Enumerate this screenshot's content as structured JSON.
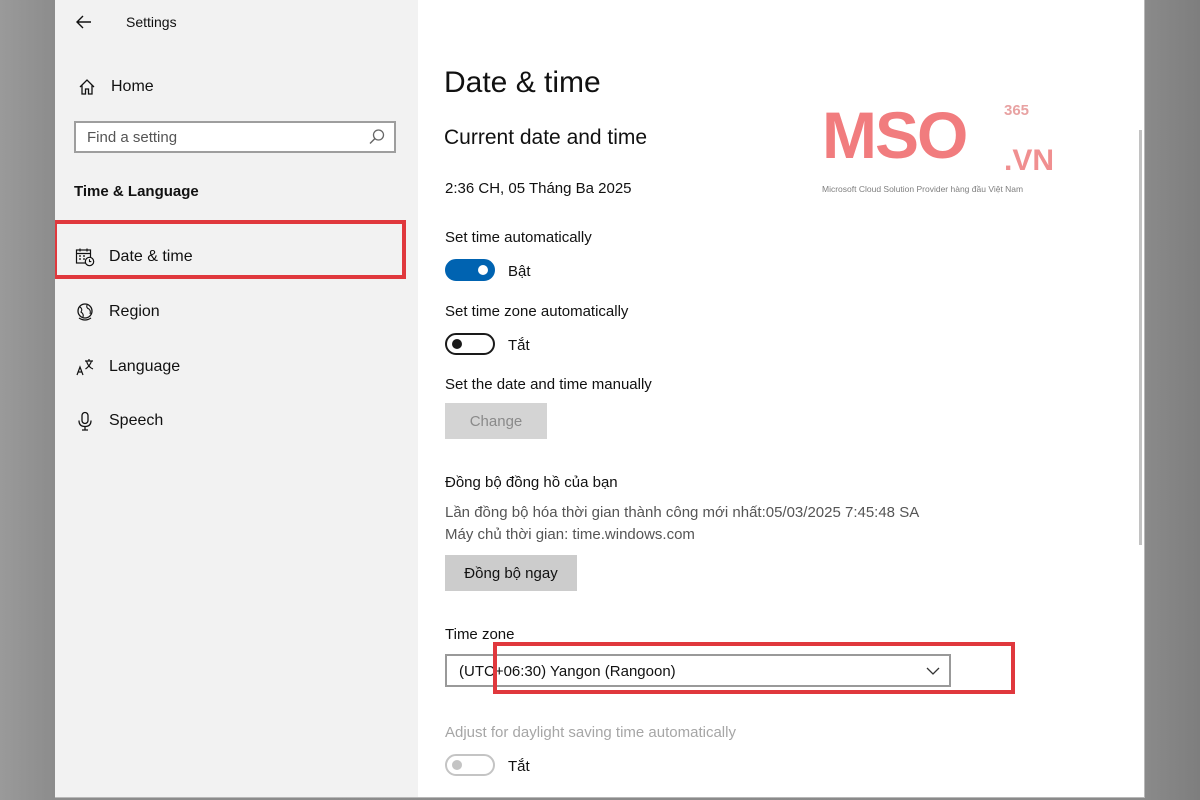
{
  "window": {
    "title": "Settings"
  },
  "sidebar": {
    "home_label": "Home",
    "search_placeholder": "Find a setting",
    "section_heading": "Time & Language",
    "items": [
      {
        "label": "Date & time",
        "icon": "calendar-clock-icon",
        "active": true
      },
      {
        "label": "Region",
        "icon": "globe-icon",
        "active": false
      },
      {
        "label": "Language",
        "icon": "language-icon",
        "active": false
      },
      {
        "label": "Speech",
        "icon": "microphone-icon",
        "active": false
      }
    ]
  },
  "main": {
    "page_title": "Date & time",
    "current_heading": "Current date and time",
    "current_value": "2:36 CH, 05 Tháng Ba 2025",
    "set_time_auto": {
      "label": "Set time automatically",
      "state": "Bật",
      "on": true
    },
    "set_tz_auto": {
      "label": "Set time zone automatically",
      "state": "Tắt",
      "on": false
    },
    "manual": {
      "label": "Set the date and time manually",
      "button": "Change"
    },
    "sync": {
      "heading": "Đồng bộ đồng hồ của bạn",
      "last_sync": "Lần đồng bộ hóa thời gian thành công mới nhất:05/03/2025 7:45:48 SA",
      "server": "Máy chủ thời gian: time.windows.com",
      "button": "Đồng bộ ngay"
    },
    "time_zone": {
      "label": "Time zone",
      "value": "(UTC+06:30) Yangon (Rangoon)"
    },
    "dst": {
      "label": "Adjust for daylight saving time automatically",
      "state": "Tắt",
      "enabled": false
    }
  },
  "watermark": {
    "brand": "MSO",
    "suffix": ".VN",
    "superscript": "365",
    "tagline": "Microsoft Cloud Solution Provider hàng đầu Việt Nam"
  },
  "colors": {
    "accent": "#0063b1",
    "highlight": "#e0383d",
    "brand": "#f17c7e"
  }
}
